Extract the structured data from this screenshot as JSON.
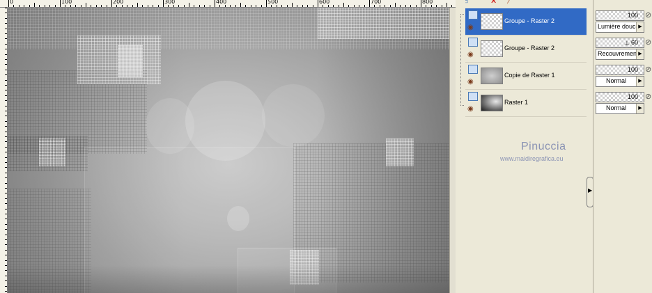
{
  "ruler": {
    "ticks": [
      "0",
      "100",
      "200",
      "300",
      "400",
      "500",
      "600",
      "700",
      "800"
    ]
  },
  "canvas": {
    "description_color": "#a9a9a9"
  },
  "layers": [
    {
      "name": "Groupe - Raster 2",
      "selected": true,
      "thumb": "checker"
    },
    {
      "name": "Groupe - Raster 2",
      "selected": false,
      "thumb": "checker"
    },
    {
      "name": "Copie de Raster 1",
      "selected": false,
      "thumb": "grey1"
    },
    {
      "name": "Raster 1",
      "selected": false,
      "thumb": "grey2"
    }
  ],
  "watermark": {
    "name": "Pinuccia",
    "url": "www.maidiregrafica.eu"
  },
  "properties": [
    {
      "opacity": "100",
      "blend": "Lumière douce"
    },
    {
      "opacity": "60",
      "blend": "Recouvrement"
    },
    {
      "opacity": "100",
      "blend": "Normal"
    },
    {
      "opacity": "100",
      "blend": "Normal"
    }
  ],
  "colors": {
    "selected": "#316ac5",
    "panel": "#ece9d8",
    "watermark": "#8a93b4"
  }
}
